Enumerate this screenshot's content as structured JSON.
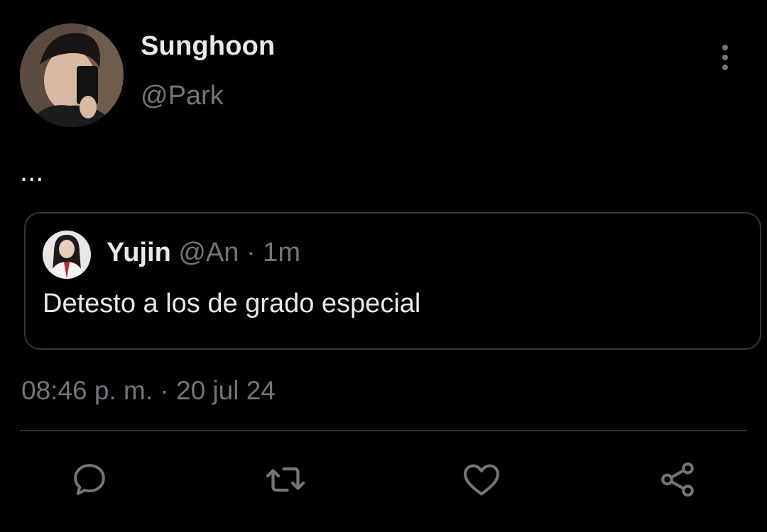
{
  "author": {
    "display_name": "Sunghoon",
    "handle": "@Park",
    "avatar_icon": "profile-photo"
  },
  "menu": {
    "icon": "more-vertical-icon"
  },
  "tweet": {
    "text": "...",
    "timestamp": "08:46 p. m. · 20 jul 24"
  },
  "quoted_tweet": {
    "display_name": "Yujin",
    "meta": "@An · 1m",
    "text": "Detesto a los de grado especial",
    "avatar_icon": "profile-photo"
  },
  "actions": [
    {
      "name": "reply",
      "icon": "reply-icon"
    },
    {
      "name": "retweet",
      "icon": "retweet-icon"
    },
    {
      "name": "like",
      "icon": "heart-icon"
    },
    {
      "name": "share",
      "icon": "share-icon"
    }
  ],
  "colors": {
    "background": "#000000",
    "primary_text": "#e7e9ea",
    "secondary_text": "#71767b",
    "border": "#333639"
  }
}
